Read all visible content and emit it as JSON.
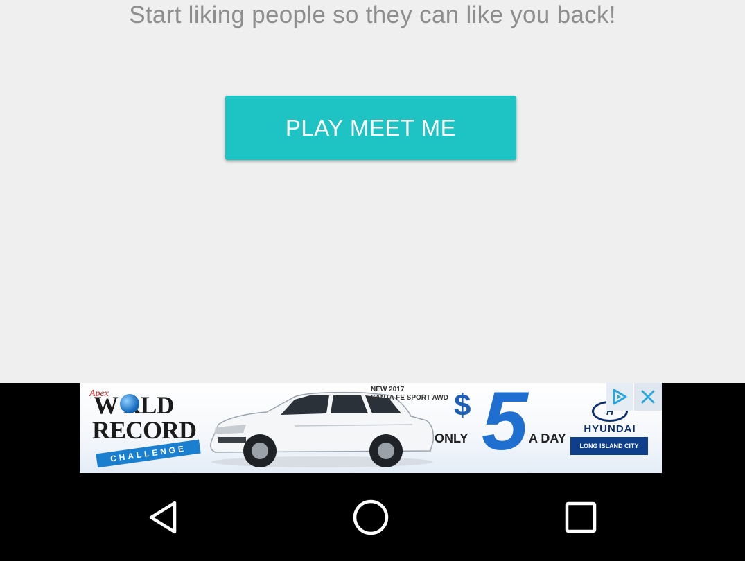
{
  "main": {
    "subtitle": "Start liking people so they can like you back!",
    "play_button_label": "PLAY MEET ME"
  },
  "ad": {
    "brand_script": "Apex",
    "title_line1": "W RLD",
    "title_line2": "RECORD",
    "ribbon": "CHALLENGE",
    "model_line1": "NEW 2017",
    "model_line2": "SANTA FE SPORT AWD",
    "price_symbol": "$",
    "price_number": "5",
    "price_prefix": "ONLY",
    "price_suffix": "A DAY",
    "brand_logo": "H",
    "brand_name": "HYUNDAI",
    "dealer": "LONG ISLAND CITY"
  },
  "colors": {
    "accent": "#1ec3c4",
    "background": "#efefef",
    "subtitle_text": "#8e8e8e",
    "navbar": "#000000"
  },
  "icons": {
    "ad_choices": "play-triangle-icon",
    "ad_close": "close-icon",
    "nav_back": "back-triangle-icon",
    "nav_home": "home-circle-icon",
    "nav_recents": "recents-square-icon"
  }
}
